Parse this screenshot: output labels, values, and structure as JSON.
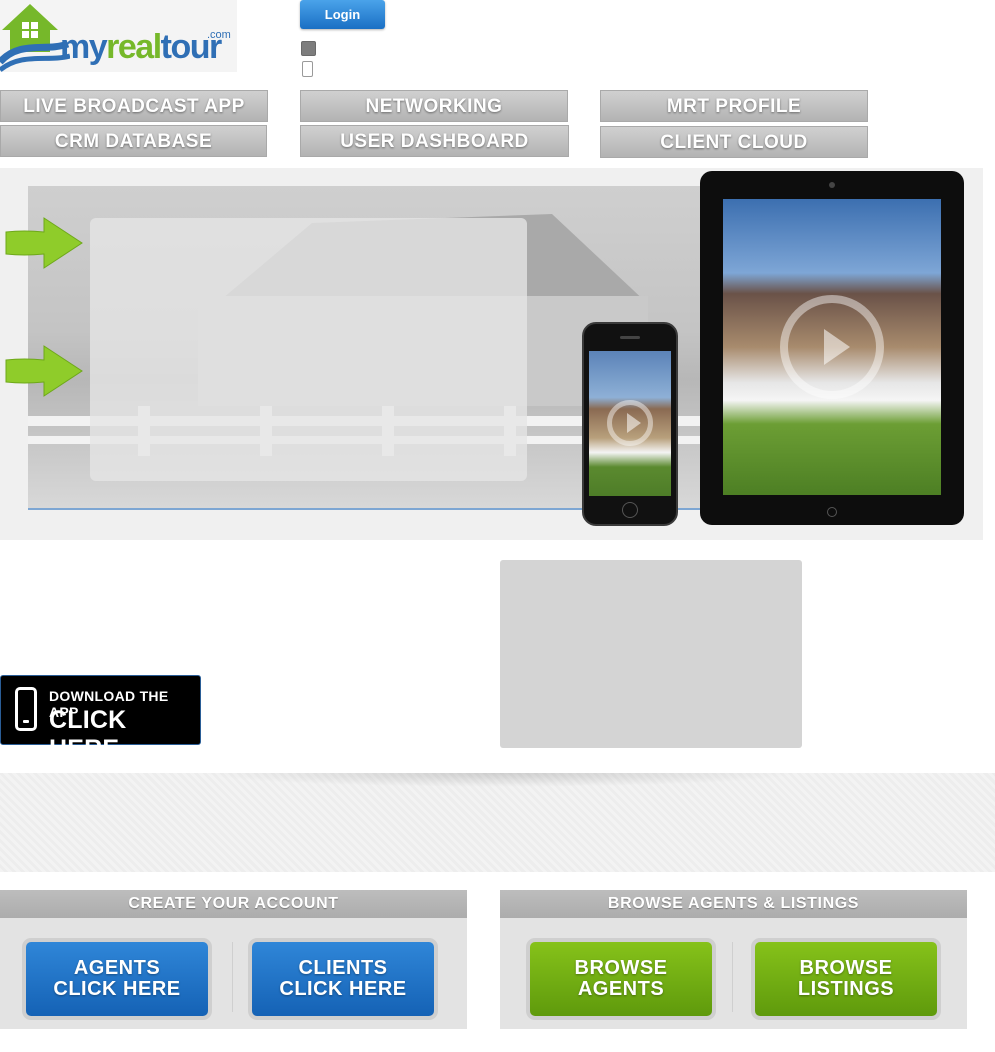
{
  "logo": {
    "my": "my",
    "real": "real",
    "tour": "tour",
    "dotcom": ".com"
  },
  "header": {
    "login_label": "Login"
  },
  "nav": {
    "live_broadcast_app": "LIVE BROADCAST APP",
    "networking": "NETWORKING",
    "mrt_profile": "MRT PROFILE",
    "crm_database": "CRM DATABASE",
    "user_dashboard": "USER DASHBOARD",
    "client_cloud": "CLIENT CLOUD"
  },
  "download_app": {
    "line1": "DOWNLOAD THE APP",
    "line2": "CLICK HERE"
  },
  "create_account": {
    "header": "CREATE YOUR ACCOUNT",
    "agents_line1": "AGENTS",
    "agents_line2": "CLICK HERE",
    "clients_line1": "CLIENTS",
    "clients_line2": "CLICK HERE"
  },
  "browse": {
    "header": "BROWSE AGENTS & LISTINGS",
    "agents_line1": "BROWSE",
    "agents_line2": "AGENTS",
    "listings_line1": "BROWSE",
    "listings_line2": "LISTINGS"
  },
  "colors": {
    "brand_blue": "#2f6fb5",
    "brand_green": "#76b82a",
    "button_blue": "#1a6fc4",
    "button_green": "#6aa812"
  }
}
